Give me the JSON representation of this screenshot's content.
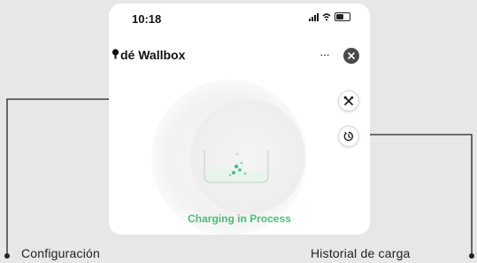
{
  "status_bar": {
    "time": "10:18"
  },
  "app": {
    "title": "dé Wallbox",
    "menu_label": "···",
    "status_text": "Charging in Process",
    "status_color": "#49c07a"
  },
  "buttons": {
    "config_icon": "tools-icon",
    "history_icon": "history-clock-icon",
    "close_icon": "close-icon"
  },
  "callouts": {
    "config_label": "Configuración",
    "history_label": "Historial de carga"
  }
}
